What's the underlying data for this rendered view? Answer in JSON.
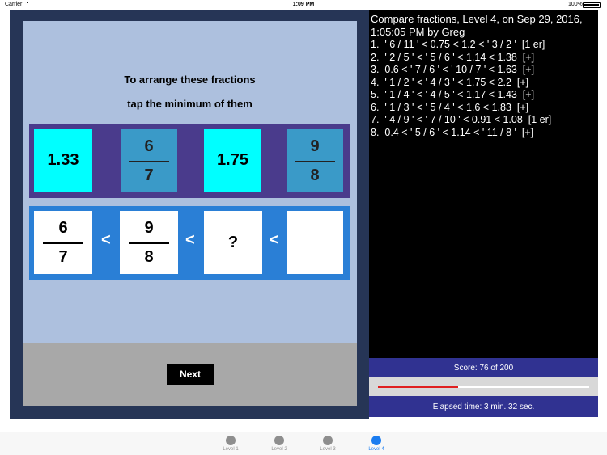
{
  "status_bar": {
    "carrier": "Carrier",
    "wifi_icon": "wifi-icon",
    "time": "1:09 PM",
    "battery_percent": "100%"
  },
  "game": {
    "instruction_line1": "To arrange these fractions",
    "instruction_line2": "tap the minimum of them",
    "choices": [
      {
        "kind": "decimal",
        "value": "1.33",
        "color": "#00ffff"
      },
      {
        "kind": "fraction",
        "numerator": "6",
        "denominator": "7",
        "color": "#3a9ac8"
      },
      {
        "kind": "decimal",
        "value": "1.75",
        "color": "#00ffff"
      },
      {
        "kind": "fraction",
        "numerator": "9",
        "denominator": "8",
        "color": "#3a9ac8"
      }
    ],
    "answer_slots": [
      {
        "numerator": "6",
        "denominator": "7"
      },
      {
        "numerator": "9",
        "denominator": "8"
      },
      {
        "placeholder": "?"
      },
      {
        "placeholder": ""
      }
    ],
    "less_than_symbol": "<",
    "next_label": "Next"
  },
  "log": {
    "header": "Compare fractions, Level 4, on Sep 29, 2016, 1:05:05 PM by Greg",
    "lines": [
      "1.  ' 6 / 11 ' < 0.75 < 1.2 < ' 3 / 2 '  [1 er]",
      "2.  ' 2 / 5 ' < ' 5 / 6 ' < 1.14 < 1.38  [+]",
      "3.  0.6 < ' 7 / 6 ' < ' 10 / 7 ' < 1.63  [+]",
      "4.  ' 1 / 2 ' < ' 4 / 3 ' < 1.75 < 2.2  [+]",
      "5.  ' 1 / 4 ' < ' 4 / 5 ' < 1.17 < 1.43  [+]",
      "6.  ' 1 / 3 ' < ' 5 / 4 ' < 1.6 < 1.83  [+]",
      "7.  ' 4 / 9 ' < ' 7 / 10 ' < 0.91 < 1.08  [1 er]",
      "8.  0.4 < ' 5 / 6 ' < 1.14 < ' 11 / 8 '  [+]"
    ]
  },
  "score": {
    "text": "Score: 76 of 200",
    "progress_fraction": 0.38
  },
  "elapsed": {
    "text": "Elapsed time: 3 min.  32 sec."
  },
  "tabs": [
    {
      "label": "Level 1",
      "active": false
    },
    {
      "label": "Level 2",
      "active": false
    },
    {
      "label": "Level 3",
      "active": false
    },
    {
      "label": "Level 4",
      "active": true
    }
  ],
  "colors": {
    "accent": "#1a7cf0",
    "progress": "#e02020",
    "score_bar": "#303291"
  }
}
